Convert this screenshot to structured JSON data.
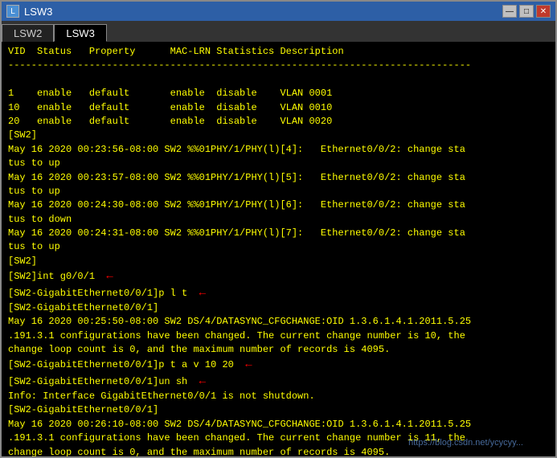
{
  "window": {
    "title": "LSW3",
    "icon": "L"
  },
  "tabs": [
    {
      "label": "LSW2",
      "active": false
    },
    {
      "label": "LSW3",
      "active": true
    }
  ],
  "controls": [
    "—",
    "□",
    "✕"
  ],
  "terminal_lines": [
    "VID  Status   Property      MAC-LRN Statistics Description",
    "--------------------------------------------------------------------------------",
    "",
    "1    enable   default       enable  disable    VLAN 0001",
    "10   enable   default       enable  disable    VLAN 0010",
    "20   enable   default       enable  disable    VLAN 0020",
    "[SW2]",
    "May 16 2020 00:23:56-08:00 SW2 %%01PHY/1/PHY(l)[4]:   Ethernet0/0/2: change sta",
    "tus to up",
    "May 16 2020 00:23:57-08:00 SW2 %%01PHY/1/PHY(l)[5]:   Ethernet0/0/2: change sta",
    "tus to up",
    "May 16 2020 00:24:30-08:00 SW2 %%01PHY/1/PHY(l)[6]:   Ethernet0/0/2: change sta",
    "tus to down",
    "May 16 2020 00:24:31-08:00 SW2 %%01PHY/1/PHY(l)[7]:   Ethernet0/0/2: change sta",
    "tus to up",
    "[SW2]",
    "[SW2]int g0/0/1",
    "[SW2-GigabitEthernet0/0/1]p l t",
    "[SW2-GigabitEthernet0/0/1]",
    "May 16 2020 00:25:50-08:00 SW2 DS/4/DATASYNC_CFGCHANGE:OID 1.3.6.1.4.1.2011.5.25",
    ".191.3.1 configurations have been changed. The current change number is 10, the",
    "change loop count is 0, and the maximum number of records is 4095.",
    "[SW2-GigabitEthernet0/0/1]p t a v 10 20",
    "[SW2-GigabitEthernet0/0/1]un sh",
    "Info: Interface GigabitEthernet0/0/1 is not shutdown.",
    "[SW2-GigabitEthernet0/0/1]",
    "May 16 2020 00:26:10-08:00 SW2 DS/4/DATASYNC_CFGCHANGE:OID 1.3.6.1.4.1.2011.5.25",
    ".191.3.1 configurations have been changed. The current change number is 11, the",
    "change loop count is 0, and the maximum number of records is 4095."
  ],
  "arrows": {
    "line_16": true,
    "line_17": true,
    "line_22": true,
    "line_23": true
  },
  "watermark": "https://blog.csdn.net/ycycyy..."
}
